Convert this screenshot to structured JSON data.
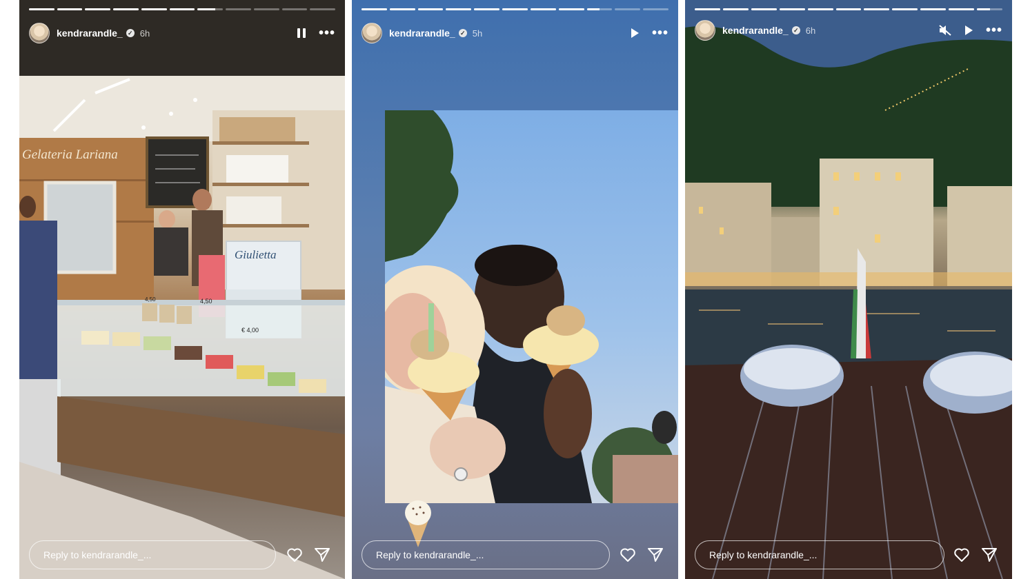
{
  "stories": [
    {
      "username": "kendrarandle_",
      "time": "6h",
      "playback_icon": "pause-icon",
      "reply_placeholder": "Reply to kendrarandle_...",
      "progress": {
        "segments": 11,
        "completed": 6,
        "current_fill": 0.7
      },
      "photo": {
        "shop_sign": "Gelateria Lariana",
        "price_1": "4,50",
        "price_2": "4,50",
        "price_3": "€ 4,00",
        "box_label": "Giulietta"
      }
    },
    {
      "username": "kendrarandle_",
      "time": "5h",
      "playback_icon": "play-icon",
      "reply_placeholder": "Reply to kendrarandle_...",
      "progress": {
        "segments": 11,
        "completed": 8,
        "current_fill": 0.5
      },
      "sticker_icon": "ice-cream-cone-icon"
    },
    {
      "username": "kendrarandle_",
      "time": "6h",
      "playback_icon": "play-icon",
      "mute_icon": "muted-speaker-icon",
      "reply_placeholder": "Reply to kendrarandle_...",
      "progress": {
        "segments": 11,
        "completed": 10,
        "current_fill": 0.5
      }
    }
  ],
  "icons": {
    "heart": "heart-icon",
    "send": "send-icon",
    "more": "more-options-icon",
    "verified": "verified-badge-icon"
  }
}
